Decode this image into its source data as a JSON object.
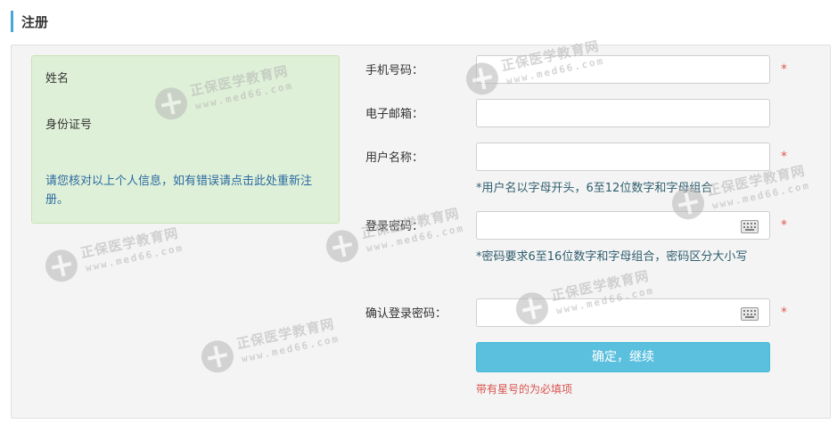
{
  "header": {
    "title": "注册"
  },
  "info": {
    "name_label": "姓名",
    "id_label": "身份证号",
    "note": "请您核对以上个人信息，如有错误请点击此处重新注册。"
  },
  "form": {
    "phone_label": "手机号码：",
    "email_label": "电子邮箱：",
    "username_label": "用户名称：",
    "username_hint": "*用户名以字母开头，6至12位数字和字母组合",
    "password_label": "登录密码：",
    "password_hint": "*密码要求6至16位数字和字母组合，密码区分大小写",
    "confirm_label": "确认登录密码：",
    "required_star": "*",
    "submit_label": "确定，继续",
    "required_note": "带有星号的为必填项"
  },
  "watermark": {
    "name": "正保医学教育网",
    "url": "www.med66.com"
  },
  "colors": {
    "accent": "#4aa6d8",
    "button": "#5bc0de",
    "info_bg": "#dff0d8",
    "required": "#e0584d"
  }
}
